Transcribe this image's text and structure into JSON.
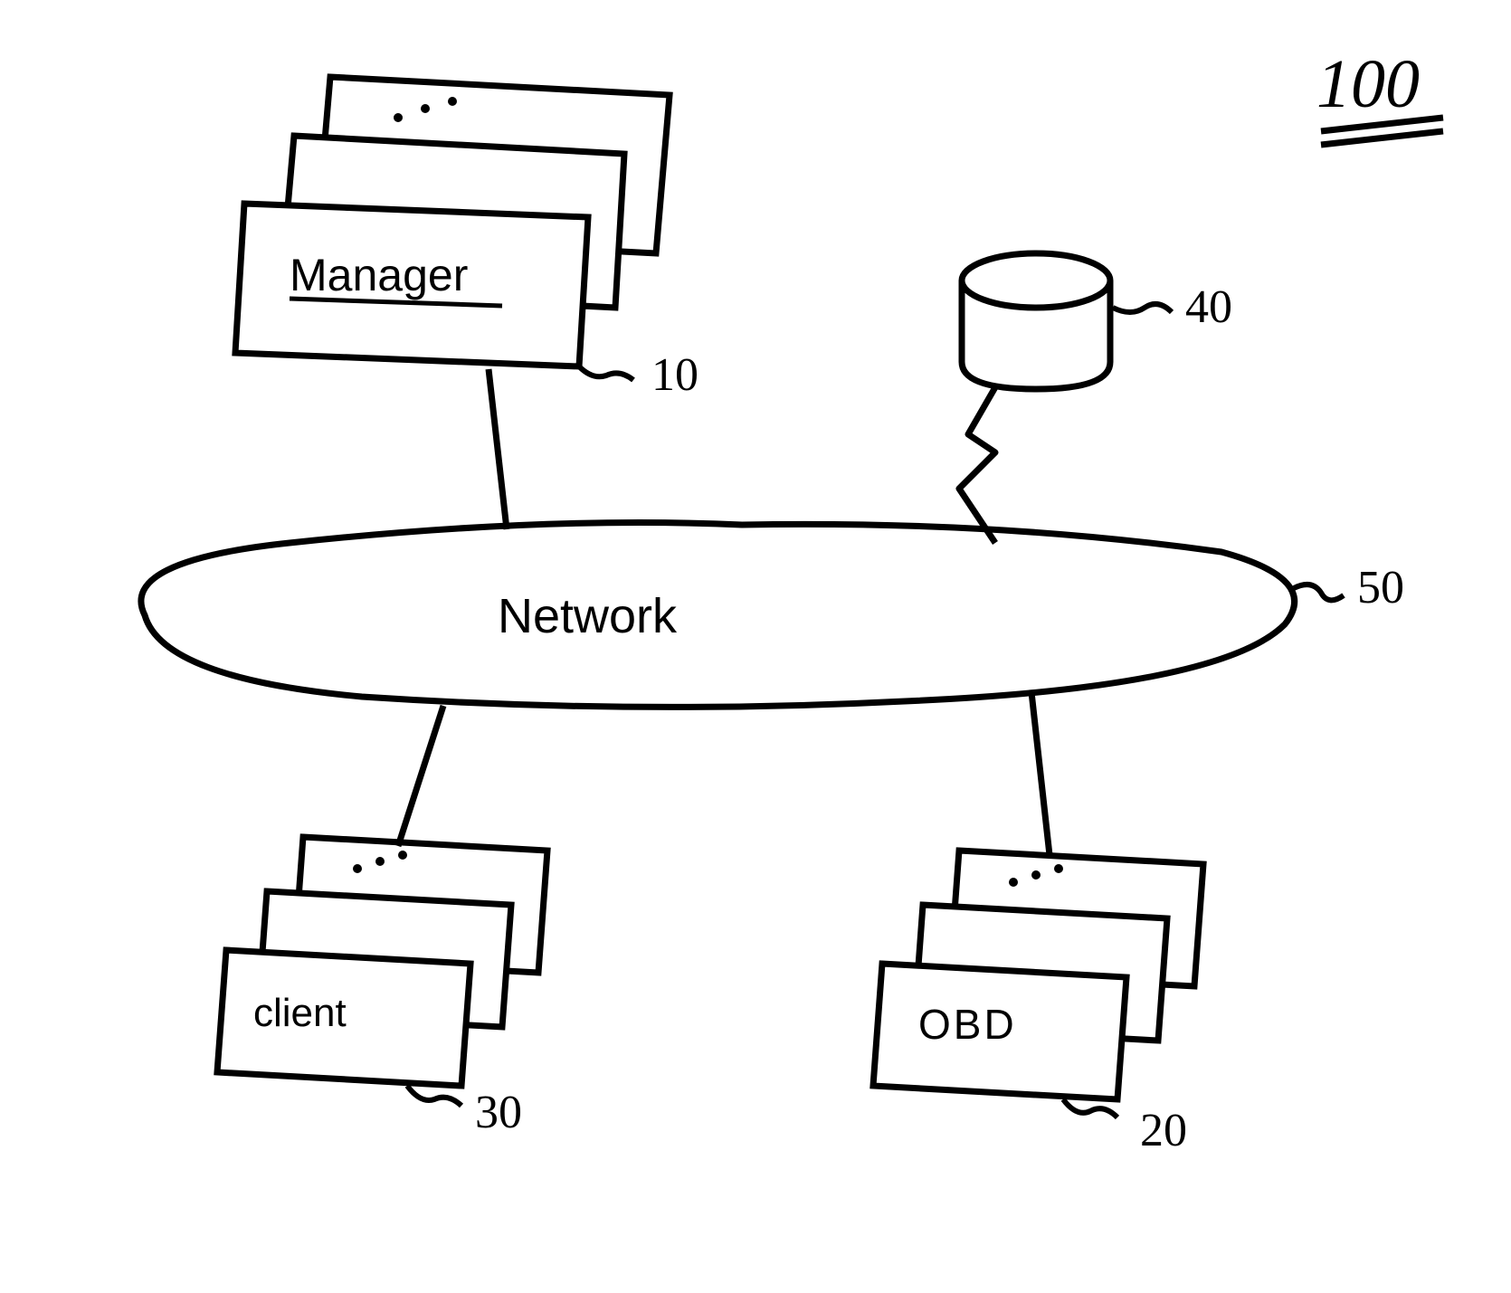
{
  "figure_number": "100",
  "nodes": {
    "manager": {
      "label": "Manager",
      "ref": "10"
    },
    "client": {
      "label": "client",
      "ref": "30"
    },
    "obd": {
      "label": "OBD",
      "ref": "20"
    },
    "database": {
      "ref": "40"
    },
    "network": {
      "label": "Network",
      "ref": "50"
    }
  }
}
